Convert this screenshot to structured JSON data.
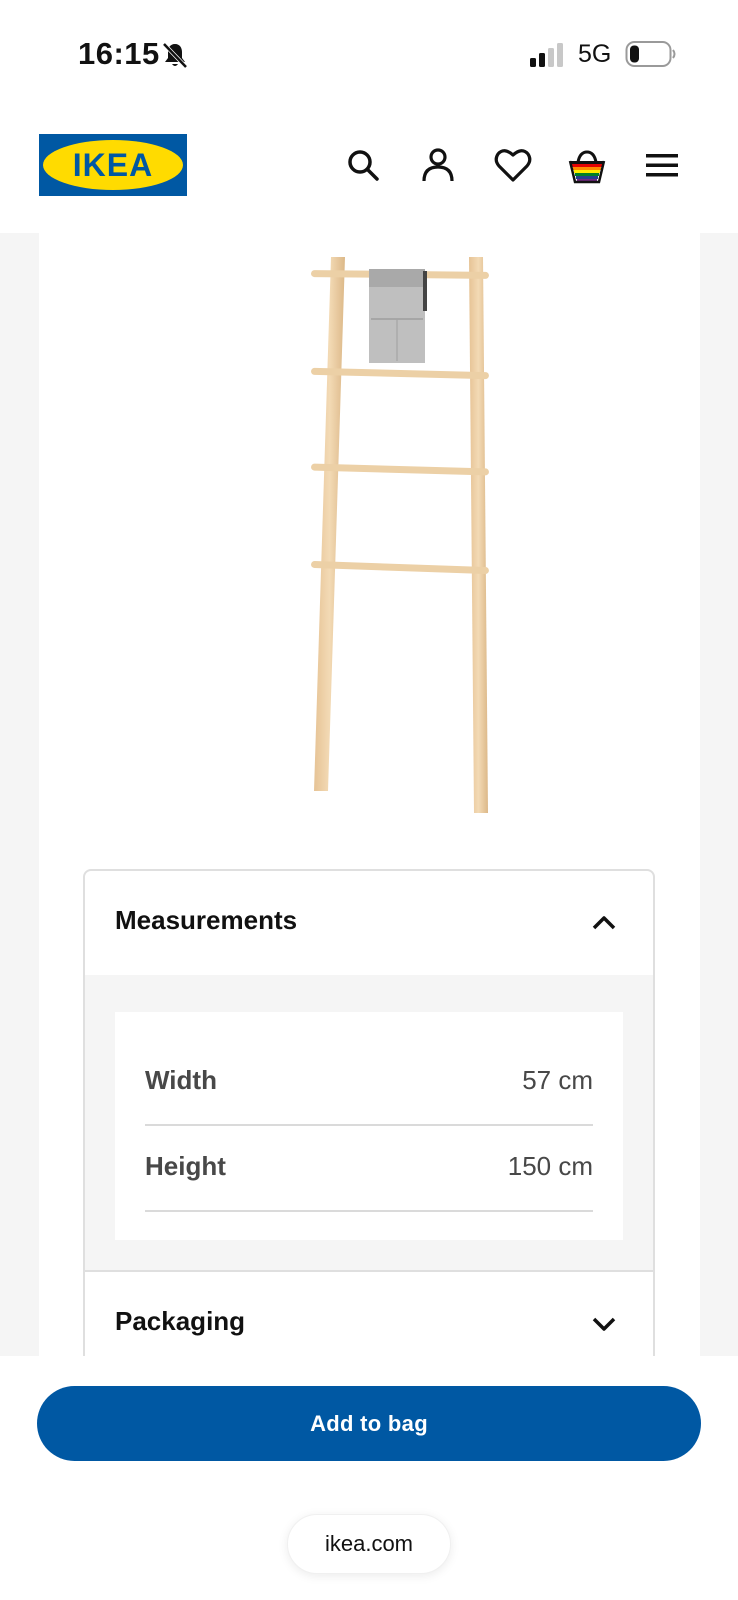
{
  "status_bar": {
    "time": "16:15",
    "network": "5G",
    "icons": [
      "bell-muted-icon",
      "signal-icon",
      "battery-icon"
    ]
  },
  "header": {
    "logo_text": "IKEA",
    "brand_colors": {
      "blue": "#0058a3",
      "yellow": "#ffdb00"
    },
    "icons": [
      "search-icon",
      "account-icon",
      "wishlist-heart-icon",
      "shopping-bag-icon",
      "menu-icon"
    ]
  },
  "product": {
    "image": "towel-ladder-icon"
  },
  "accordion": {
    "measurements": {
      "title": "Measurements",
      "expanded": true,
      "rows": [
        {
          "label": "Width",
          "value": "57 cm"
        },
        {
          "label": "Height",
          "value": "150 cm"
        }
      ]
    },
    "packaging": {
      "title": "Packaging",
      "expanded": false
    }
  },
  "actions": {
    "add_to_bag_label": "Add to bag",
    "accent_color": "#0058a3"
  },
  "browser": {
    "url": "ikea.com"
  }
}
